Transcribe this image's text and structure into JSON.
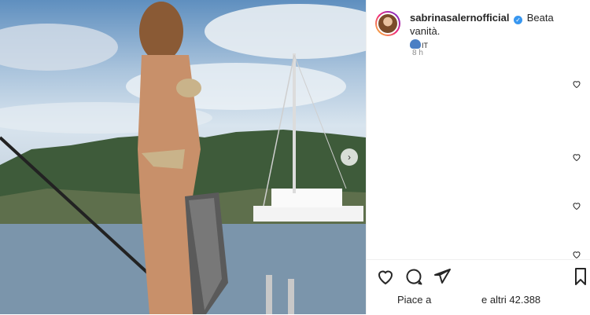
{
  "post": {
    "username": "sabrinasalernofficial",
    "caption": "Beata vanità.",
    "emoji_suffix": "IT",
    "timestamp": "8 h"
  },
  "likes": {
    "prefix": "Piace a",
    "suffix": "e altri 42.388"
  },
  "icons": {
    "like": "heart-icon",
    "comment": "comment-icon",
    "share": "share-icon",
    "save": "bookmark-icon",
    "next": "chevron-right-icon"
  },
  "colors": {
    "verified": "#3897f0",
    "text": "#262626",
    "muted": "#8e8e8e"
  }
}
